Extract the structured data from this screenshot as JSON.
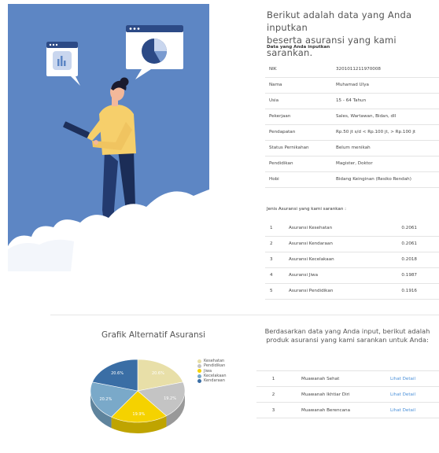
{
  "intro": {
    "line1": "Berikut adalah data yang Anda inputkan",
    "line2": "beserta asuransi yang kami sarankan."
  },
  "input_section": {
    "label": "Data yang Anda inputkan",
    "rows": [
      {
        "key": "NIK",
        "value": "3201011211970008"
      },
      {
        "key": "Nama",
        "value": "Muhamad Ulya"
      },
      {
        "key": "Usia",
        "value": "15 - 64 Tahun"
      },
      {
        "key": "Pekerjaan",
        "value": "Sales, Wartawan, Bidan, dll"
      },
      {
        "key": "Pendapatan",
        "value": "Rp.50 jt s/d < Rp.100 jt, > Rp.100 jt"
      },
      {
        "key": "Status Pernikahan",
        "value": "Belum menikah"
      },
      {
        "key": "Pendidikan",
        "value": "Magister, Doktor"
      },
      {
        "key": "Hobi",
        "value": "Bidang Keinginan (Resiko Rendah)"
      }
    ]
  },
  "ranking_section": {
    "label": "Jenis Asuransi yang kami sarankan :",
    "rows": [
      {
        "no": "1",
        "name": "Asuransi Kesehatan",
        "score": "0.2061"
      },
      {
        "no": "2",
        "name": "Asuransi Kendaraan",
        "score": "0.2061"
      },
      {
        "no": "3",
        "name": "Asuransi Kecelakaan",
        "score": "0.2018"
      },
      {
        "no": "4",
        "name": "Asuransi Jiwa",
        "score": "0.1987"
      },
      {
        "no": "5",
        "name": "Asuransi Pendidikan",
        "score": "0.1916"
      }
    ]
  },
  "chart": {
    "title": "Grafik Alternatif Asuransi",
    "legend": [
      {
        "label": "Kesehatan",
        "color": "#e8dfa8"
      },
      {
        "label": "Pendidikan",
        "color": "#c4c4c4"
      },
      {
        "label": "Jiwa",
        "color": "#f5d200"
      },
      {
        "label": "Kecelakaan",
        "color": "#7aa9c9"
      },
      {
        "label": "Kendaraan",
        "color": "#3a6ea5"
      }
    ]
  },
  "chart_data": {
    "type": "pie",
    "title": "Grafik Alternatif Asuransi",
    "slices": [
      {
        "name": "Kesehatan",
        "value": 20.6,
        "label": "20.6%",
        "color": "#e8dfa8"
      },
      {
        "name": "Pendidikan",
        "value": 19.2,
        "label": "19.2%",
        "color": "#c4c4c4"
      },
      {
        "name": "Jiwa",
        "value": 19.9,
        "label": "19.9%",
        "color": "#f5d200"
      },
      {
        "name": "Kecelakaan",
        "value": 20.2,
        "label": "20.2%",
        "color": "#7aa9c9"
      },
      {
        "name": "Kendaraan",
        "value": 20.6,
        "label": "20.6%",
        "color": "#3a6ea5"
      }
    ],
    "legend_position": "right"
  },
  "recommendation": {
    "line1": "Berdasarkan data yang Anda input, berikut adalah",
    "line2": "produk asuransi yang kami sarankan untuk Anda:",
    "rows": [
      {
        "no": "1",
        "name": "Muawanah Sehat",
        "link": "Lihat Detail"
      },
      {
        "no": "2",
        "name": "Muawanah Ikhtiar Diri",
        "link": "Lihat Detail"
      },
      {
        "no": "3",
        "name": "Muawanah Berencana",
        "link": "Lihat Detail"
      }
    ]
  }
}
